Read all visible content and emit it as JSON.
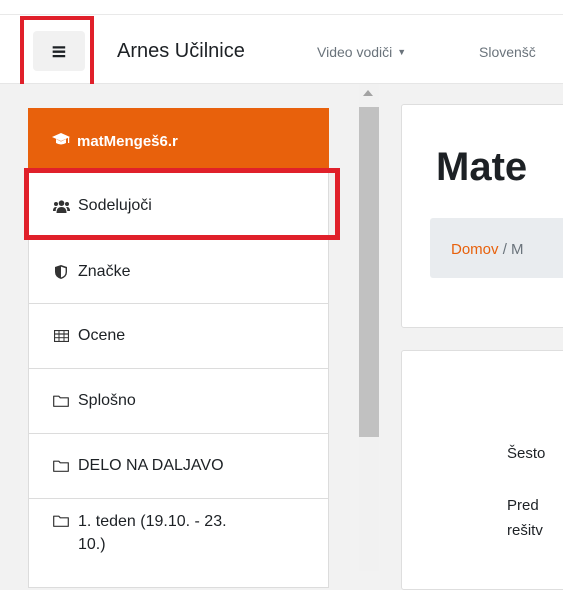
{
  "header": {
    "menu_icon": "hamburger-icon",
    "menu_glyph": "≡",
    "brand": "Arnes Učilnice",
    "nav_links": [
      "Video vodiči",
      "Slovenšč"
    ]
  },
  "drawer": {
    "course": {
      "icon": "graduation-cap-icon",
      "label": "matMengeš6.r"
    },
    "items": [
      {
        "icon": "users-icon",
        "label": "Sodelujoči"
      },
      {
        "icon": "shield-icon",
        "label": "Značke"
      },
      {
        "icon": "table-icon",
        "label": "Ocene"
      },
      {
        "icon": "folder-icon",
        "label": "Splošno"
      },
      {
        "icon": "folder-icon",
        "label": "DELO NA DALJAVO"
      },
      {
        "icon": "folder-icon",
        "label": "1. teden (19.10. - 23.",
        "label2": "10.)"
      }
    ]
  },
  "main": {
    "title": "Mate",
    "breadcrumb": {
      "home": "Domov",
      "separator": "/",
      "next": "M"
    },
    "content_lines": [
      "Šesto",
      "Pred",
      "rešitv"
    ]
  },
  "colors": {
    "accent": "#e8610c",
    "highlight": "#e0202a"
  }
}
